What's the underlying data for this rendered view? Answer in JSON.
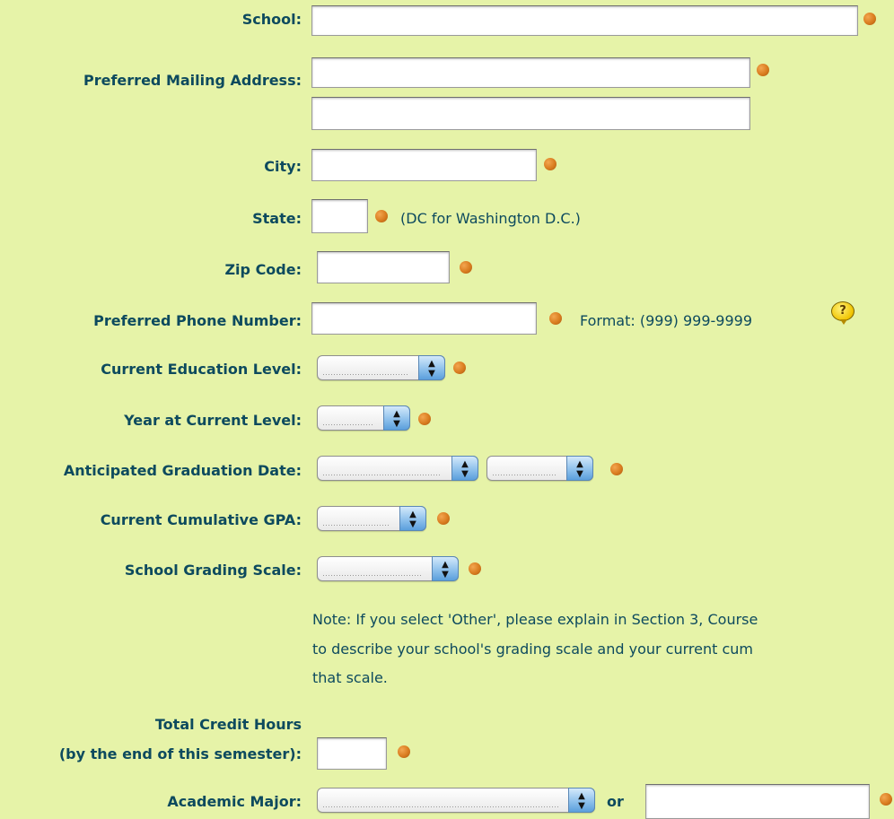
{
  "fields": {
    "school": {
      "label": "School:"
    },
    "mailing": {
      "label": "Preferred Mailing Address:"
    },
    "city": {
      "label": "City:"
    },
    "state": {
      "label": "State:",
      "hint": "(DC for Washington D.C.)"
    },
    "zip": {
      "label": "Zip Code:"
    },
    "phone": {
      "label": "Preferred Phone Number:",
      "hint": "Format: (999) 999-9999",
      "help_glyph": "?"
    },
    "edu_level": {
      "label": "Current Education Level:"
    },
    "year_level": {
      "label": "Year at Current Level:"
    },
    "grad_date": {
      "label": "Anticipated Graduation Date:"
    },
    "gpa": {
      "label": "Current Cumulative GPA:"
    },
    "grading_scale": {
      "label": "School Grading Scale:"
    },
    "credit_hours": {
      "label_line1": "Total Credit Hours",
      "label_line2": "(by the end of this semester):"
    },
    "major": {
      "label": "Academic Major:",
      "or_text": "or"
    }
  },
  "note": {
    "line1": "Note: If you select 'Other', please explain in Section 3, Course",
    "line2": "to describe your school's grading scale and your current cum",
    "line3": "that scale."
  },
  "icons": {
    "required": "required-dot-icon",
    "help": "help-bubble-icon",
    "select_arrows": "updown-arrows-icon"
  },
  "colors": {
    "background": "#e6f3a8",
    "label": "#0d4a5e",
    "required_dot": "#d97c1f"
  }
}
